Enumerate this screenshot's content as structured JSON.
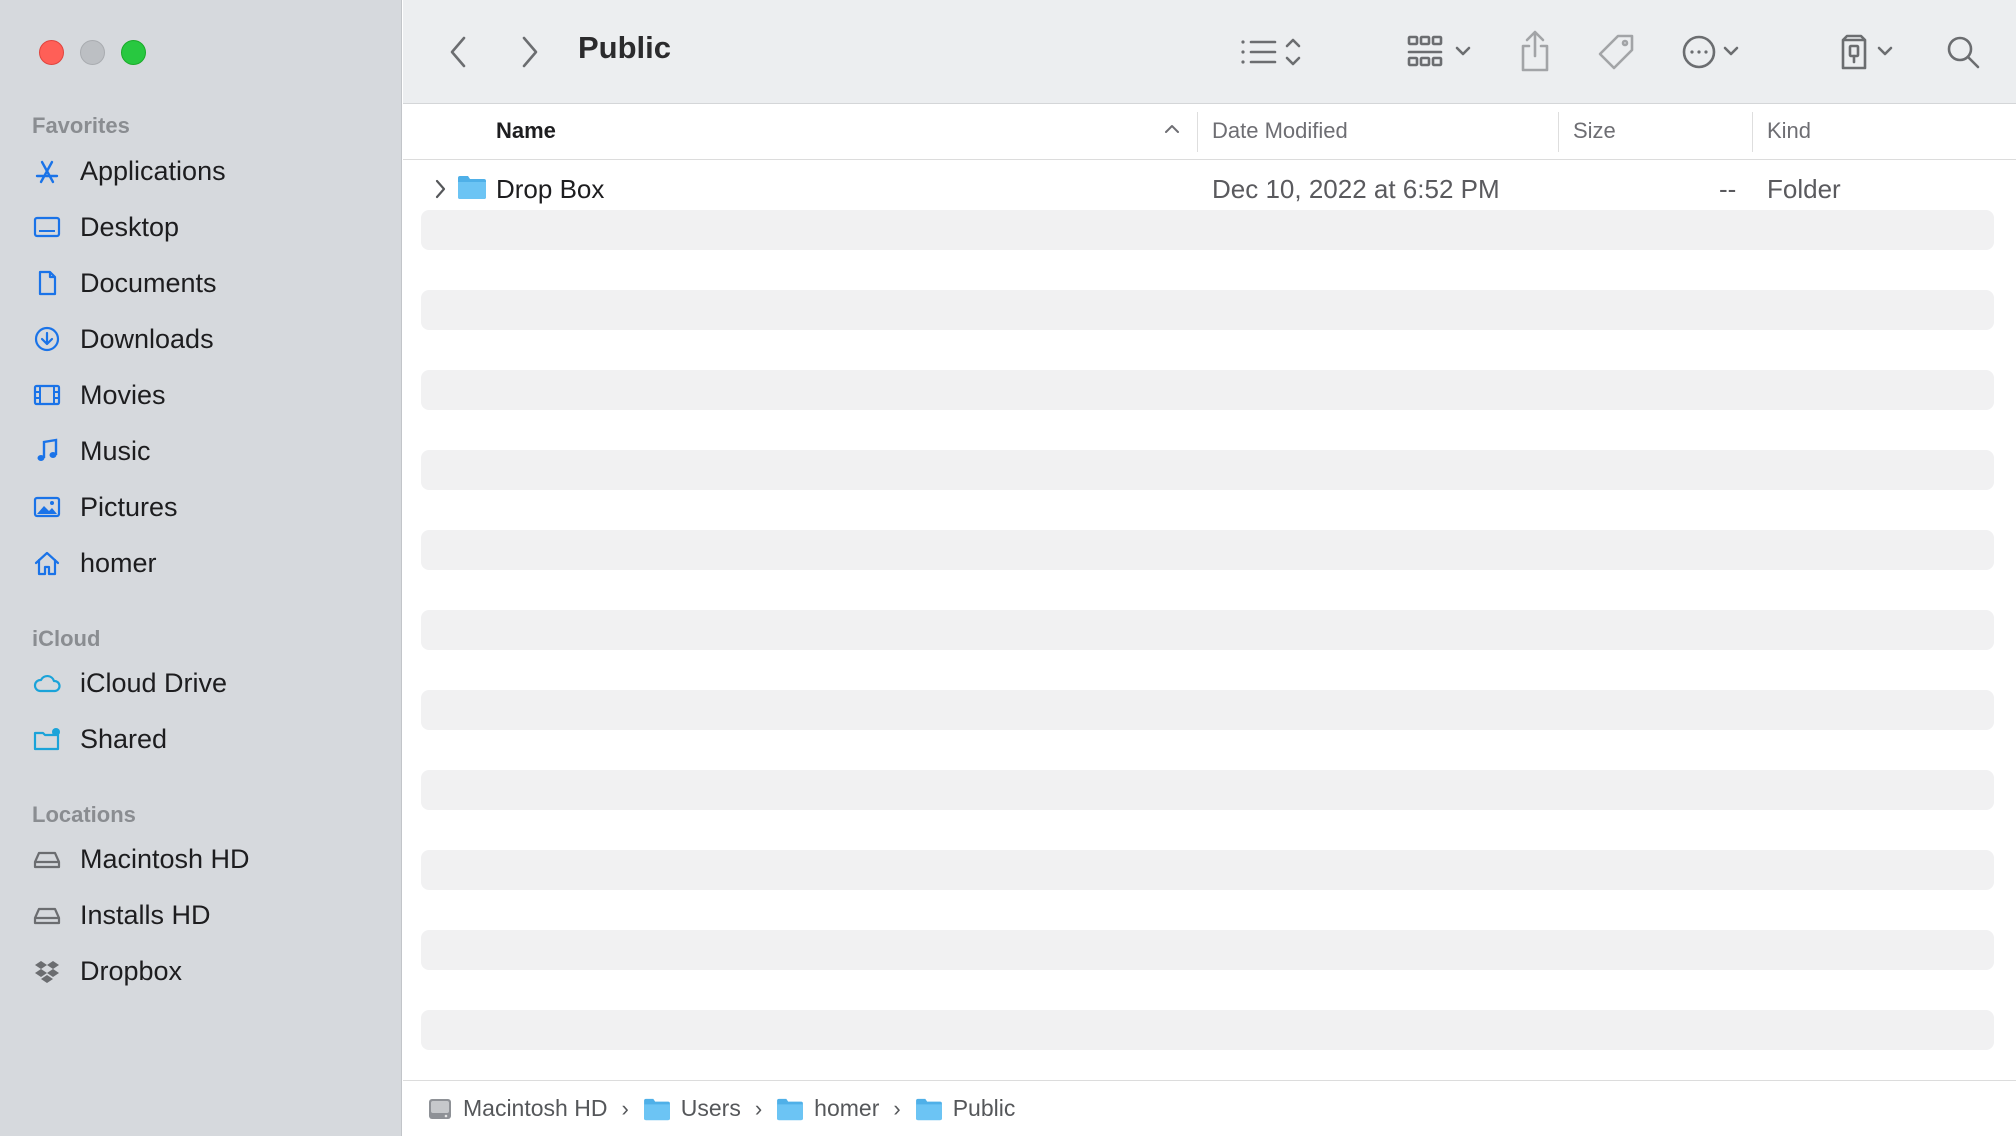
{
  "window": {
    "title": "Public"
  },
  "sidebar": {
    "sections": {
      "favorites": "Favorites",
      "icloud": "iCloud",
      "locations": "Locations"
    },
    "favorites": [
      {
        "label": "Applications",
        "icon": "applications-icon"
      },
      {
        "label": "Desktop",
        "icon": "desktop-icon"
      },
      {
        "label": "Documents",
        "icon": "document-icon"
      },
      {
        "label": "Downloads",
        "icon": "download-icon"
      },
      {
        "label": "Movies",
        "icon": "film-icon"
      },
      {
        "label": "Music",
        "icon": "music-note-icon"
      },
      {
        "label": "Pictures",
        "icon": "photo-icon"
      },
      {
        "label": "homer",
        "icon": "home-icon"
      }
    ],
    "icloud": [
      {
        "label": "iCloud Drive",
        "icon": "cloud-icon"
      },
      {
        "label": "Shared",
        "icon": "shared-folder-icon"
      }
    ],
    "locations": [
      {
        "label": "Macintosh HD",
        "icon": "drive-icon"
      },
      {
        "label": "Installs HD",
        "icon": "drive-icon"
      },
      {
        "label": "Dropbox",
        "icon": "dropbox-icon"
      }
    ]
  },
  "columns": {
    "name": "Name",
    "date_modified": "Date Modified",
    "size": "Size",
    "kind": "Kind"
  },
  "files": [
    {
      "name": "Drop Box",
      "date_modified": "Dec 10, 2022 at 6:52 PM",
      "size": "--",
      "kind": "Folder"
    }
  ],
  "pathbar": [
    "Macintosh HD",
    "Users",
    "homer",
    "Public"
  ],
  "colors": {
    "accent": "#1a73e8",
    "sidebar_bg": "#d6d9dd",
    "stripe": "#f1f1f2",
    "close": "#ff5f57",
    "zoom": "#28c840"
  }
}
